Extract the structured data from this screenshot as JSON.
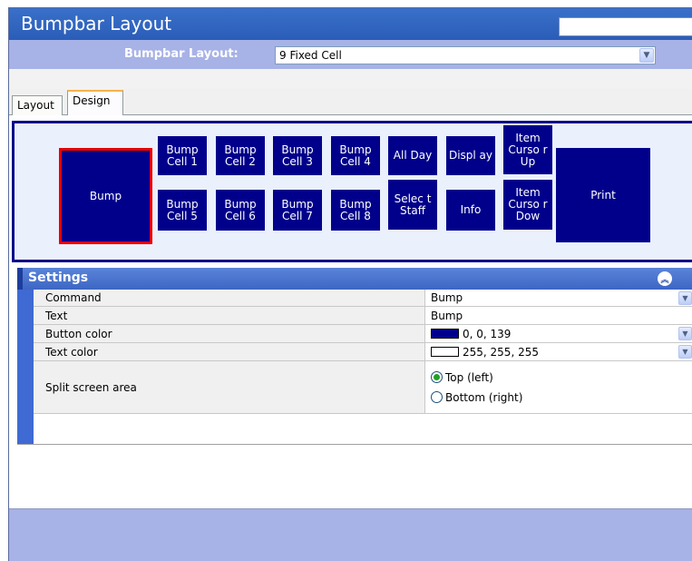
{
  "window": {
    "title": "Bumpbar Layout"
  },
  "selector": {
    "label": "Bumpbar Layout:",
    "value": "9 Fixed Cell"
  },
  "tabs": [
    {
      "label": "Layout",
      "active": false
    },
    {
      "label": "Design",
      "active": true
    }
  ],
  "bumpbar": {
    "button_color": "#00008b",
    "selected_border_color": "#e80000",
    "big_left": "Bump",
    "big_right": "Print",
    "top_row": [
      "Bump Cell 1",
      "Bump Cell 2",
      "Bump Cell 3",
      "Bump Cell 4",
      "All Day",
      "Displ ay",
      "Item Curso r Up"
    ],
    "bottom_row": [
      "Bump Cell 5",
      "Bump Cell 6",
      "Bump Cell 7",
      "Bump Cell 8",
      "Selec t Staff",
      "Info",
      "Item Curso r Dow"
    ]
  },
  "settings": {
    "title": "Settings",
    "collapse_icon": "chevron-up-double-icon",
    "rows": {
      "command": {
        "name": "Command",
        "value": "Bump"
      },
      "text": {
        "name": "Text",
        "value": "Bump"
      },
      "button_color": {
        "name": "Button color",
        "value": "0, 0, 139",
        "swatch": "#00008b"
      },
      "text_color": {
        "name": "Text color",
        "value": "255, 255, 255",
        "swatch": "#ffffff"
      },
      "split": {
        "name": "Split screen area",
        "options": [
          "Top (left)",
          "Bottom (right)"
        ],
        "selected": "Top (left)"
      }
    }
  }
}
